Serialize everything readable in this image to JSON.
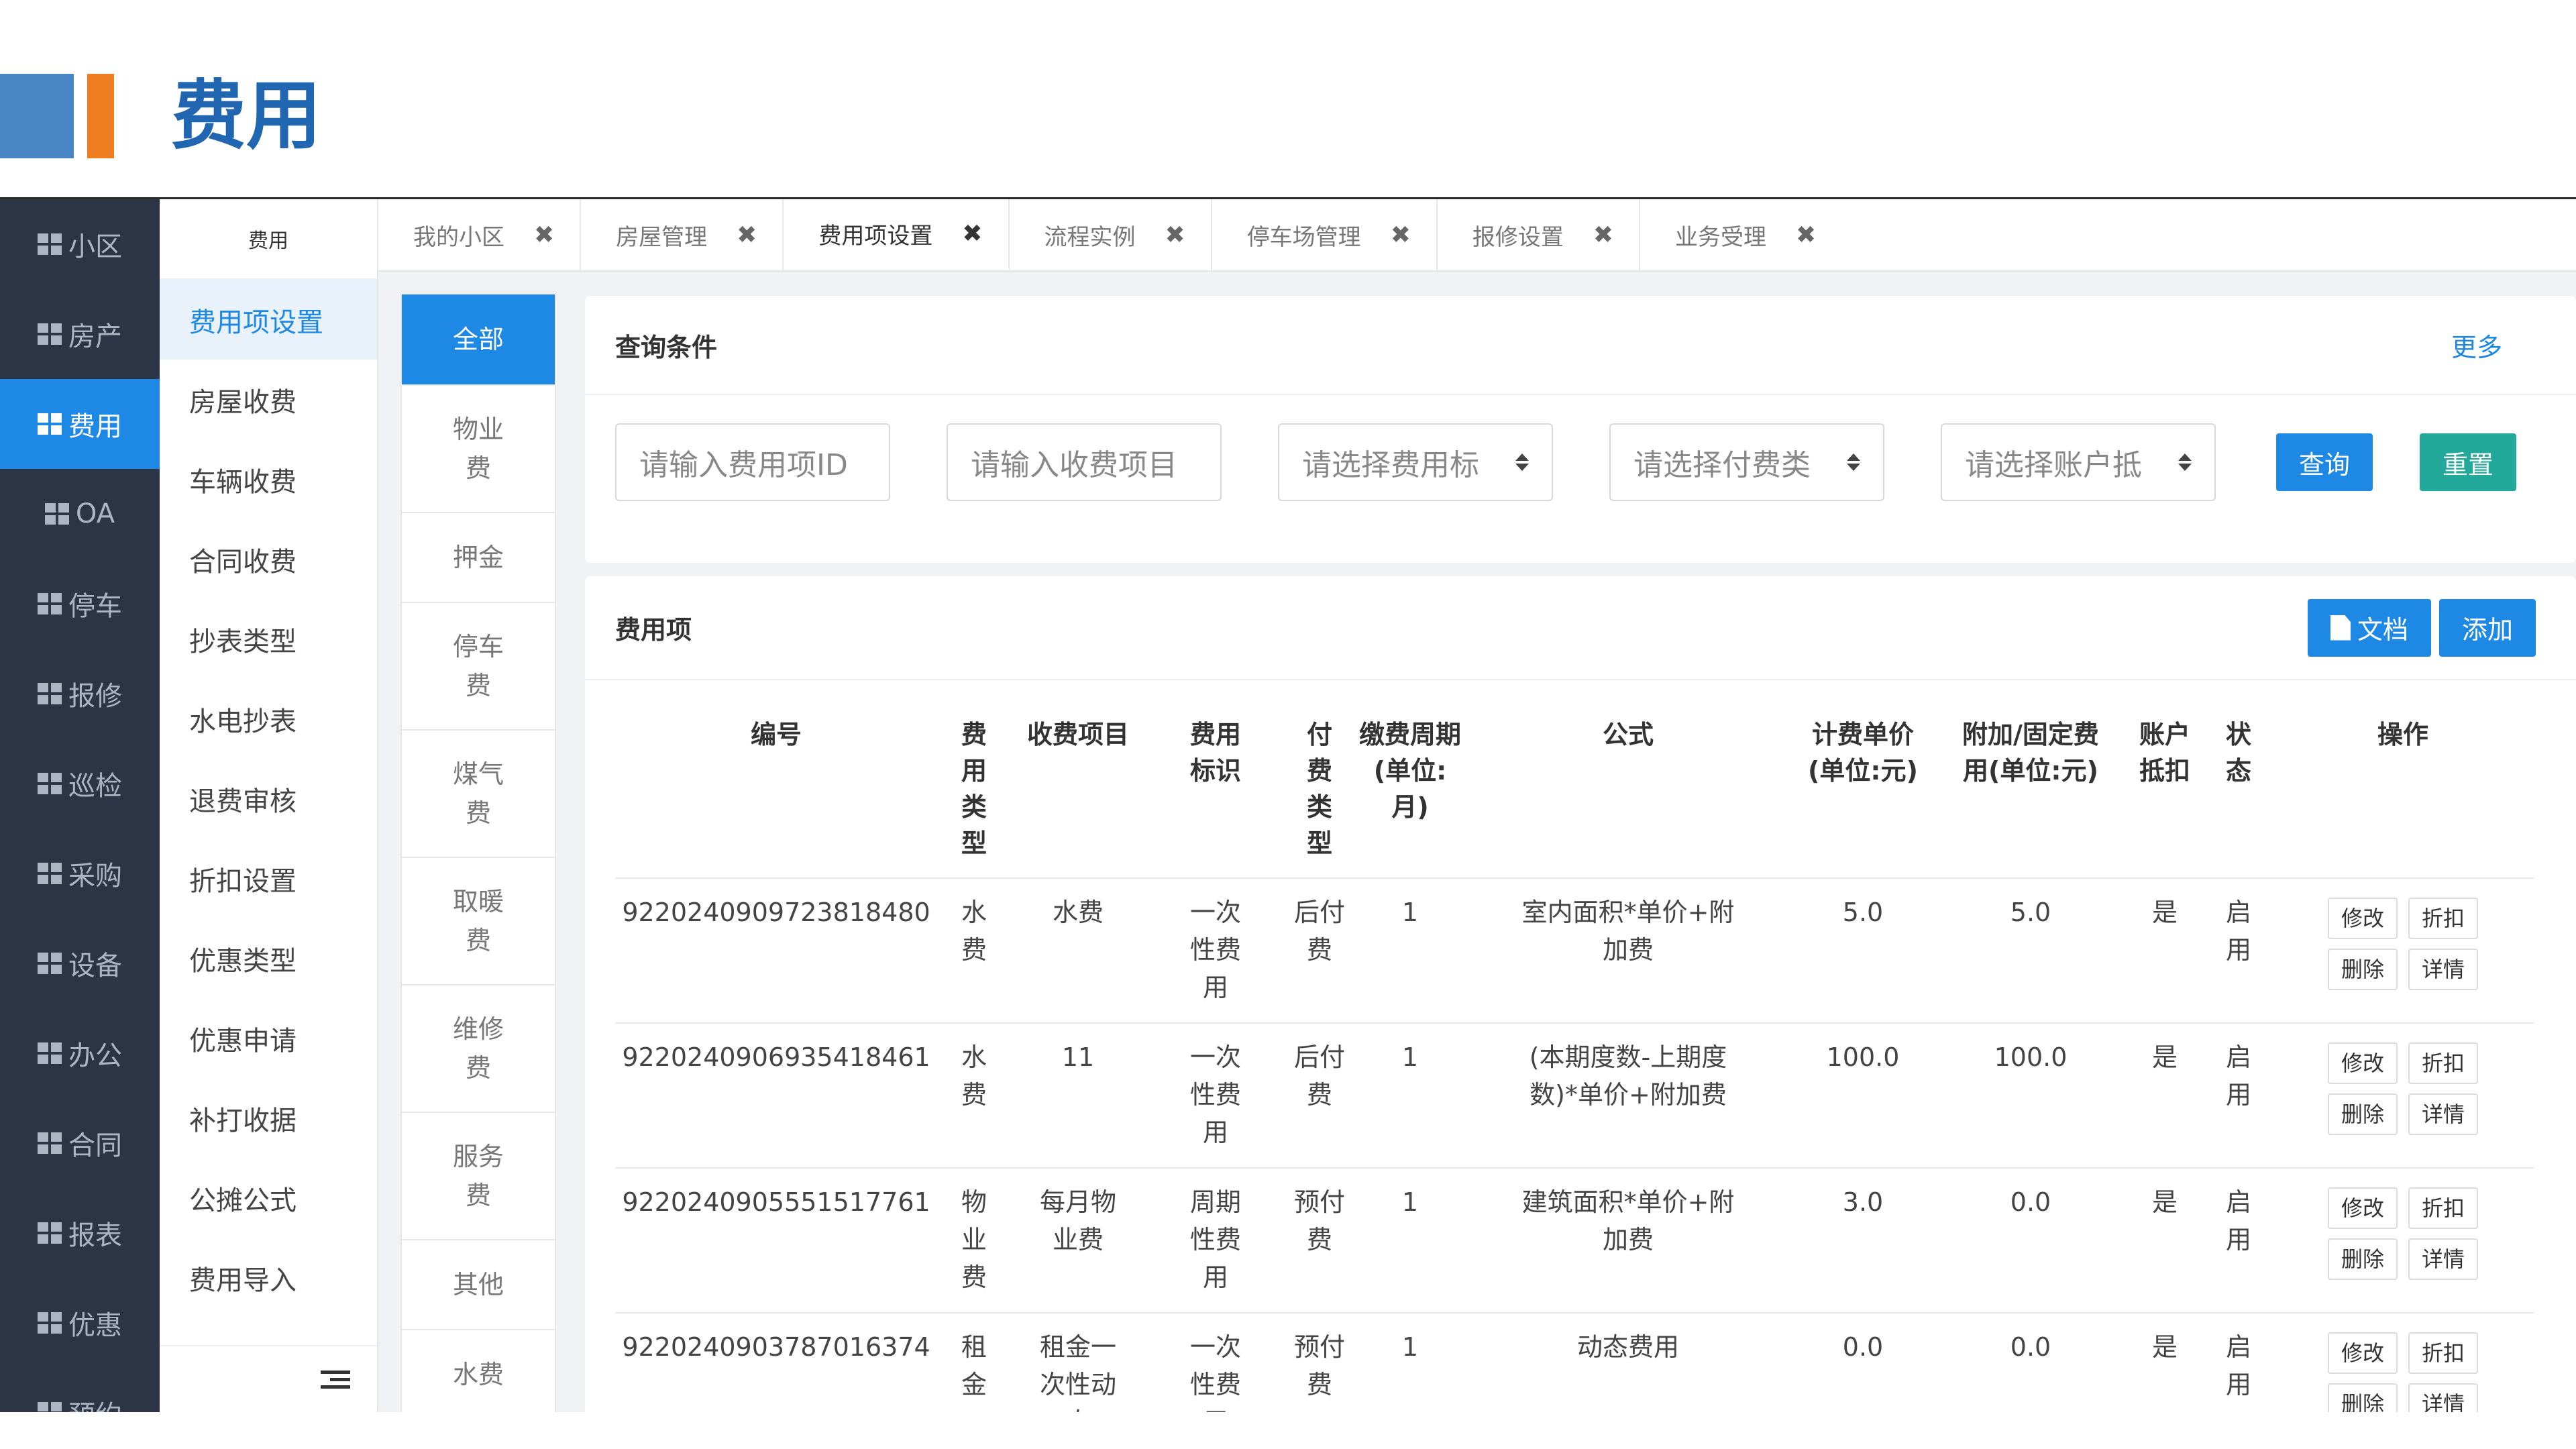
{
  "slide": {
    "title": "费用"
  },
  "main_menu": [
    {
      "label": "小区"
    },
    {
      "label": "房产"
    },
    {
      "label": "费用",
      "active": true
    },
    {
      "label": "OA"
    },
    {
      "label": "停车"
    },
    {
      "label": "报修"
    },
    {
      "label": "巡检"
    },
    {
      "label": "采购"
    },
    {
      "label": "设备"
    },
    {
      "label": "办公"
    },
    {
      "label": "合同"
    },
    {
      "label": "报表"
    },
    {
      "label": "优惠"
    },
    {
      "label": "预约"
    }
  ],
  "sub_menu": {
    "title": "费用",
    "items": [
      {
        "label": "费用项设置",
        "active": true
      },
      {
        "label": "房屋收费"
      },
      {
        "label": "车辆收费"
      },
      {
        "label": "合同收费"
      },
      {
        "label": "抄表类型"
      },
      {
        "label": "水电抄表"
      },
      {
        "label": "退费审核"
      },
      {
        "label": "折扣设置"
      },
      {
        "label": "优惠类型"
      },
      {
        "label": "优惠申请"
      },
      {
        "label": "补打收据"
      },
      {
        "label": "公摊公式"
      },
      {
        "label": "费用导入"
      }
    ]
  },
  "tabs": [
    {
      "label": "我的小区"
    },
    {
      "label": "房屋管理"
    },
    {
      "label": "费用项设置",
      "active": true
    },
    {
      "label": "流程实例"
    },
    {
      "label": "停车场管理"
    },
    {
      "label": "报修设置"
    },
    {
      "label": "业务受理"
    }
  ],
  "categories": [
    {
      "label": "全部",
      "active": true
    },
    {
      "label": "物业费"
    },
    {
      "label": "押金"
    },
    {
      "label": "停车费"
    },
    {
      "label": "煤气费"
    },
    {
      "label": "取暖费"
    },
    {
      "label": "维修费"
    },
    {
      "label": "服务费"
    },
    {
      "label": "其他"
    },
    {
      "label": "水费"
    }
  ],
  "query": {
    "title": "查询条件",
    "more": "更多",
    "fee_id_placeholder": "请输入费用项ID",
    "item_placeholder": "请输入收费项目",
    "fee_flag_placeholder": "请选择费用标",
    "pay_type_placeholder": "请选择付费类",
    "account_placeholder": "请选择账户抵",
    "search_label": "查询",
    "reset_label": "重置"
  },
  "fees": {
    "title": "费用项",
    "doc_label": "文档",
    "add_label": "添加",
    "columns": [
      "编号",
      "费用类型",
      "收费项目",
      "费用标识",
      "付费类型",
      "缴费周期(单位:月)",
      "公式",
      "计费单价(单位:元)",
      "附加/固定费用(单位:元)",
      "账户抵扣",
      "状态",
      "操作"
    ],
    "rows": [
      {
        "id": "9220240909723818480",
        "type": "水费",
        "item": "水费",
        "flag": "一次性费用",
        "pay": "后付费",
        "cycle": "1",
        "formula": "室内面积*单价+附加费",
        "price": "5.0",
        "extra": "5.0",
        "deduct": "是",
        "status": "启用"
      },
      {
        "id": "9220240906935418461",
        "type": "水费",
        "item": "11",
        "flag": "一次性费用",
        "pay": "后付费",
        "cycle": "1",
        "formula": "(本期度数-上期度数)*单价+附加费",
        "price": "100.0",
        "extra": "100.0",
        "deduct": "是",
        "status": "启用"
      },
      {
        "id": "9220240905551517761",
        "type": "物业费",
        "item": "每月物业费",
        "flag": "周期性费用",
        "pay": "预付费",
        "cycle": "1",
        "formula": "建筑面积*单价+附加费",
        "price": "3.0",
        "extra": "0.0",
        "deduct": "是",
        "status": "启用"
      },
      {
        "id": "9220240903787016374",
        "type": "租金",
        "item": "租金一次性动态",
        "flag": "一次性费用",
        "pay": "预付费",
        "cycle": "1",
        "formula": "动态费用",
        "price": "0.0",
        "extra": "0.0",
        "deduct": "是",
        "status": "启用"
      }
    ],
    "ops": {
      "edit": "修改",
      "discount": "折扣",
      "delete": "删除",
      "detail": "详情"
    }
  }
}
